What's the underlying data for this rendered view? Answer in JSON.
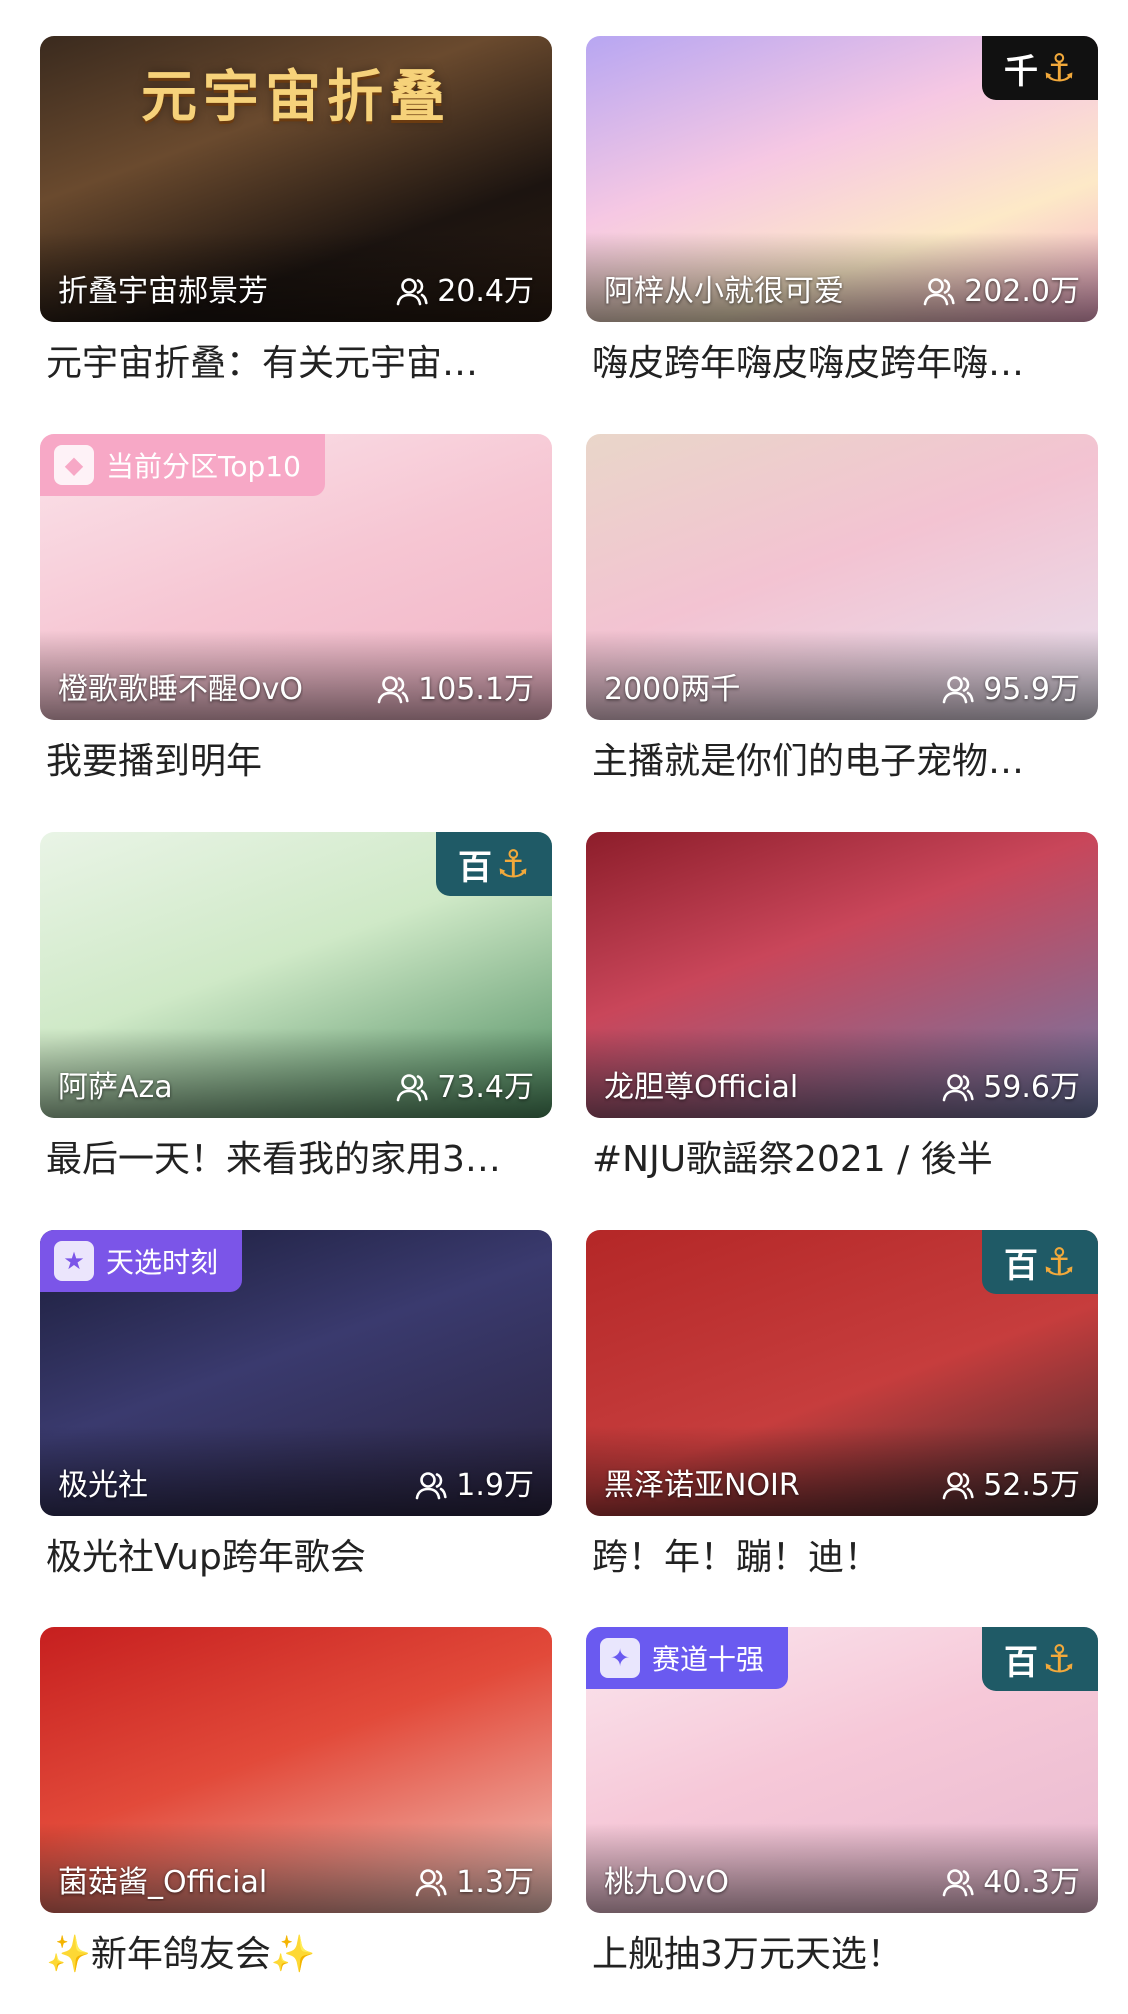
{
  "colors": {
    "anchor_badge_bg": "#1f5a66",
    "thousand_badge_bg": "#111111",
    "top10_badge": "#f25d9c",
    "pick_badge": "#8a5cf6",
    "lane_badge": "#6b5cf6"
  },
  "cards": [
    {
      "art_text": "元宇宙折叠",
      "streamer": "折叠宇宙郝景芳",
      "viewers": "20.4万",
      "title": "元宇宙折叠：有关元宇宙…",
      "corner_badge": null,
      "tag": null,
      "bg": "linear-gradient(160deg,#3a2a1e 0%,#6a4a2e 35%,#1c1410 70%,#2b1c12 100%)"
    },
    {
      "art_text": "",
      "streamer": "阿梓从小就很可爱",
      "viewers": "202.0万",
      "title": "嗨皮跨年嗨皮嗨皮跨年嗨…",
      "corner_badge": {
        "text": "千",
        "icon": "anchor-icon",
        "bg": "#111111"
      },
      "tag": null,
      "bg": "linear-gradient(160deg,#b7a6f2 0%,#f6c8e3 40%,#fde9c7 70%,#f3a8cb 100%)"
    },
    {
      "art_text": "",
      "streamer": "橙歌歌睡不醒OvO",
      "viewers": "105.1万",
      "title": "我要播到明年",
      "corner_badge": null,
      "tag": {
        "text": "当前分区Top10",
        "icon": "rank-icon",
        "bg": "#f7a8c6"
      },
      "bg": "linear-gradient(160deg,#fbe3ea 0%,#f6c6d3 50%,#f0b4c6 100%)"
    },
    {
      "art_text": "",
      "streamer": "2000两千",
      "viewers": "95.9万",
      "title": "主播就是你们的电子宠物…",
      "corner_badge": null,
      "tag": null,
      "bg": "linear-gradient(160deg,#e9d6c9 0%,#f3c3d2 45%,#e7e1ef 100%)"
    },
    {
      "art_text": "",
      "streamer": "阿萨Aza",
      "viewers": "73.4万",
      "title": "最后一天！来看我的家用3…",
      "corner_badge": {
        "text": "百",
        "icon": "anchor-icon",
        "bg": "#1f5a66"
      },
      "tag": null,
      "bg": "linear-gradient(160deg,#e9f4e6 0%,#cfe9c7 45%,#4b8a5e 100%)"
    },
    {
      "art_text": "",
      "streamer": "龙胆尊Official",
      "viewers": "59.6万",
      "title": "#NJU歌謡祭2021 / 後半",
      "corner_badge": null,
      "tag": null,
      "bg": "linear-gradient(160deg,#8c1d2a 0%,#c9465a 40%,#6e7aa8 100%)"
    },
    {
      "art_text": "",
      "streamer": "极光社",
      "viewers": "1.9万",
      "title": "极光社Vup跨年歌会",
      "corner_badge": null,
      "tag": {
        "text": "天选时刻",
        "icon": "ticket-icon",
        "bg": "#7b55e8"
      },
      "bg": "linear-gradient(160deg,#1b1d3a 0%,#3a3a6e 45%,#2a2440 100%)"
    },
    {
      "art_text": "",
      "streamer": "黑泽诺亚NOIR",
      "viewers": "52.5万",
      "title": "跨！年！蹦！迪！",
      "corner_badge": {
        "text": "百",
        "icon": "anchor-icon",
        "bg": "#1f5a66"
      },
      "tag": null,
      "bg": "linear-gradient(160deg,#b42727 0%,#c63d3d 55%,#3a2a2e 100%)"
    },
    {
      "art_text": "",
      "streamer": "菌菇酱_Official",
      "viewers": "1.3万",
      "title": "✨新年鸽友会✨",
      "corner_badge": null,
      "tag": null,
      "bg": "linear-gradient(160deg,#c61f1f 0%,#e24a3a 45%,#f3c8c0 100%)"
    },
    {
      "art_text": "",
      "streamer": "桃九OvO",
      "viewers": "40.3万",
      "title": "上舰抽3万元天选！",
      "corner_badge": {
        "text": "百",
        "icon": "anchor-icon",
        "bg": "#1f5a66"
      },
      "tag": {
        "text": "赛道十强",
        "icon": "star-icon",
        "bg": "#6a5af0"
      },
      "bg": "linear-gradient(160deg,#fbe6ee 0%,#f6c8d8 45%,#e7b9cf 100%)"
    }
  ]
}
